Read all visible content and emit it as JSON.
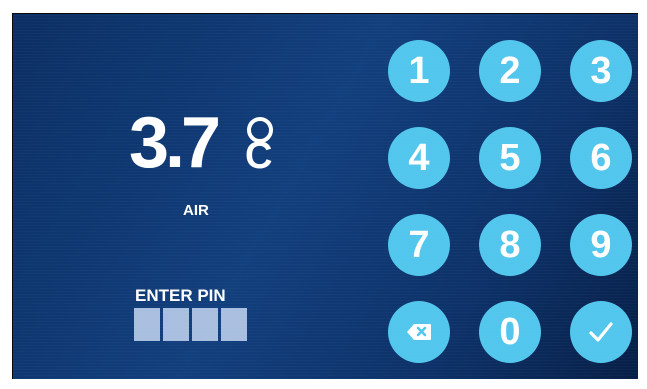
{
  "display": {
    "temperature": "3.7",
    "unit": "C",
    "sensor_label": "AIR"
  },
  "pin": {
    "prompt": "ENTER PIN",
    "digits_entered": 0,
    "length": 4
  },
  "keypad": {
    "keys": [
      "1",
      "2",
      "3",
      "4",
      "5",
      "6",
      "7",
      "8",
      "9",
      "0"
    ],
    "backspace_icon": "backspace-icon",
    "confirm_icon": "checkmark-icon"
  },
  "colors": {
    "background": "#123f7d",
    "key_fill": "#52c6ec",
    "pin_box": "#a9bfe0",
    "text": "#ffffff"
  }
}
